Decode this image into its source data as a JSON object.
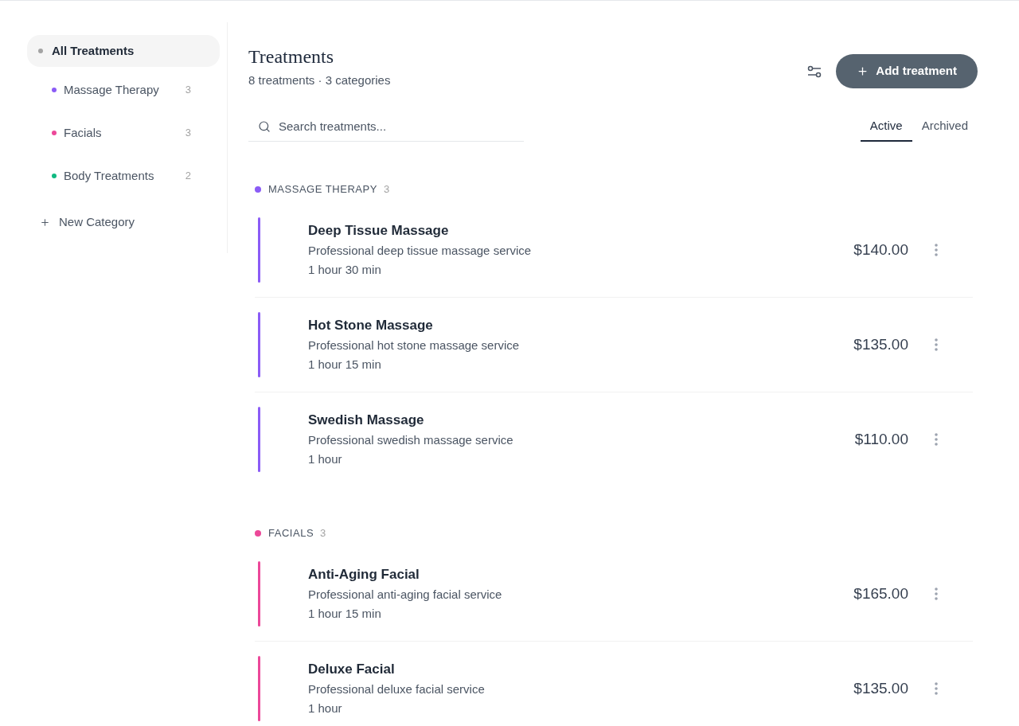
{
  "sidebar": {
    "items": [
      {
        "label": "All Treatments",
        "selected": true,
        "color": "#a3a3a3"
      },
      {
        "label": "Massage Therapy",
        "count": "3",
        "selected": false,
        "color": "#8b5cf6"
      },
      {
        "label": "Facials",
        "count": "3",
        "selected": false,
        "color": "#ec4899"
      },
      {
        "label": "Body Treatments",
        "count": "2",
        "selected": false,
        "color": "#10b981"
      }
    ],
    "new_category": "New Category"
  },
  "header": {
    "title": "Treatments",
    "subtitle": "8 treatments · 3 categories",
    "add_button": "Add treatment"
  },
  "search": {
    "placeholder": "Search treatments..."
  },
  "tabs": [
    {
      "label": "Active",
      "selected": true
    },
    {
      "label": "Archived",
      "selected": false
    }
  ],
  "categories": [
    {
      "name": "MASSAGE THERAPY",
      "count": "3",
      "color": "#8b5cf6",
      "treatments": [
        {
          "name": "Deep Tissue Massage",
          "description": "Professional deep tissue massage service",
          "duration": "1 hour 30 min",
          "price": "$140.00"
        },
        {
          "name": "Hot Stone Massage",
          "description": "Professional hot stone massage service",
          "duration": "1 hour 15 min",
          "price": "$135.00"
        },
        {
          "name": "Swedish Massage",
          "description": "Professional swedish massage service",
          "duration": "1 hour",
          "price": "$110.00"
        }
      ]
    },
    {
      "name": "FACIALS",
      "count": "3",
      "color": "#ec4899",
      "treatments": [
        {
          "name": "Anti-Aging Facial",
          "description": "Professional anti-aging facial service",
          "duration": "1 hour 15 min",
          "price": "$165.00"
        },
        {
          "name": "Deluxe Facial",
          "description": "Professional deluxe facial service",
          "duration": "1 hour",
          "price": "$135.00"
        }
      ]
    }
  ]
}
